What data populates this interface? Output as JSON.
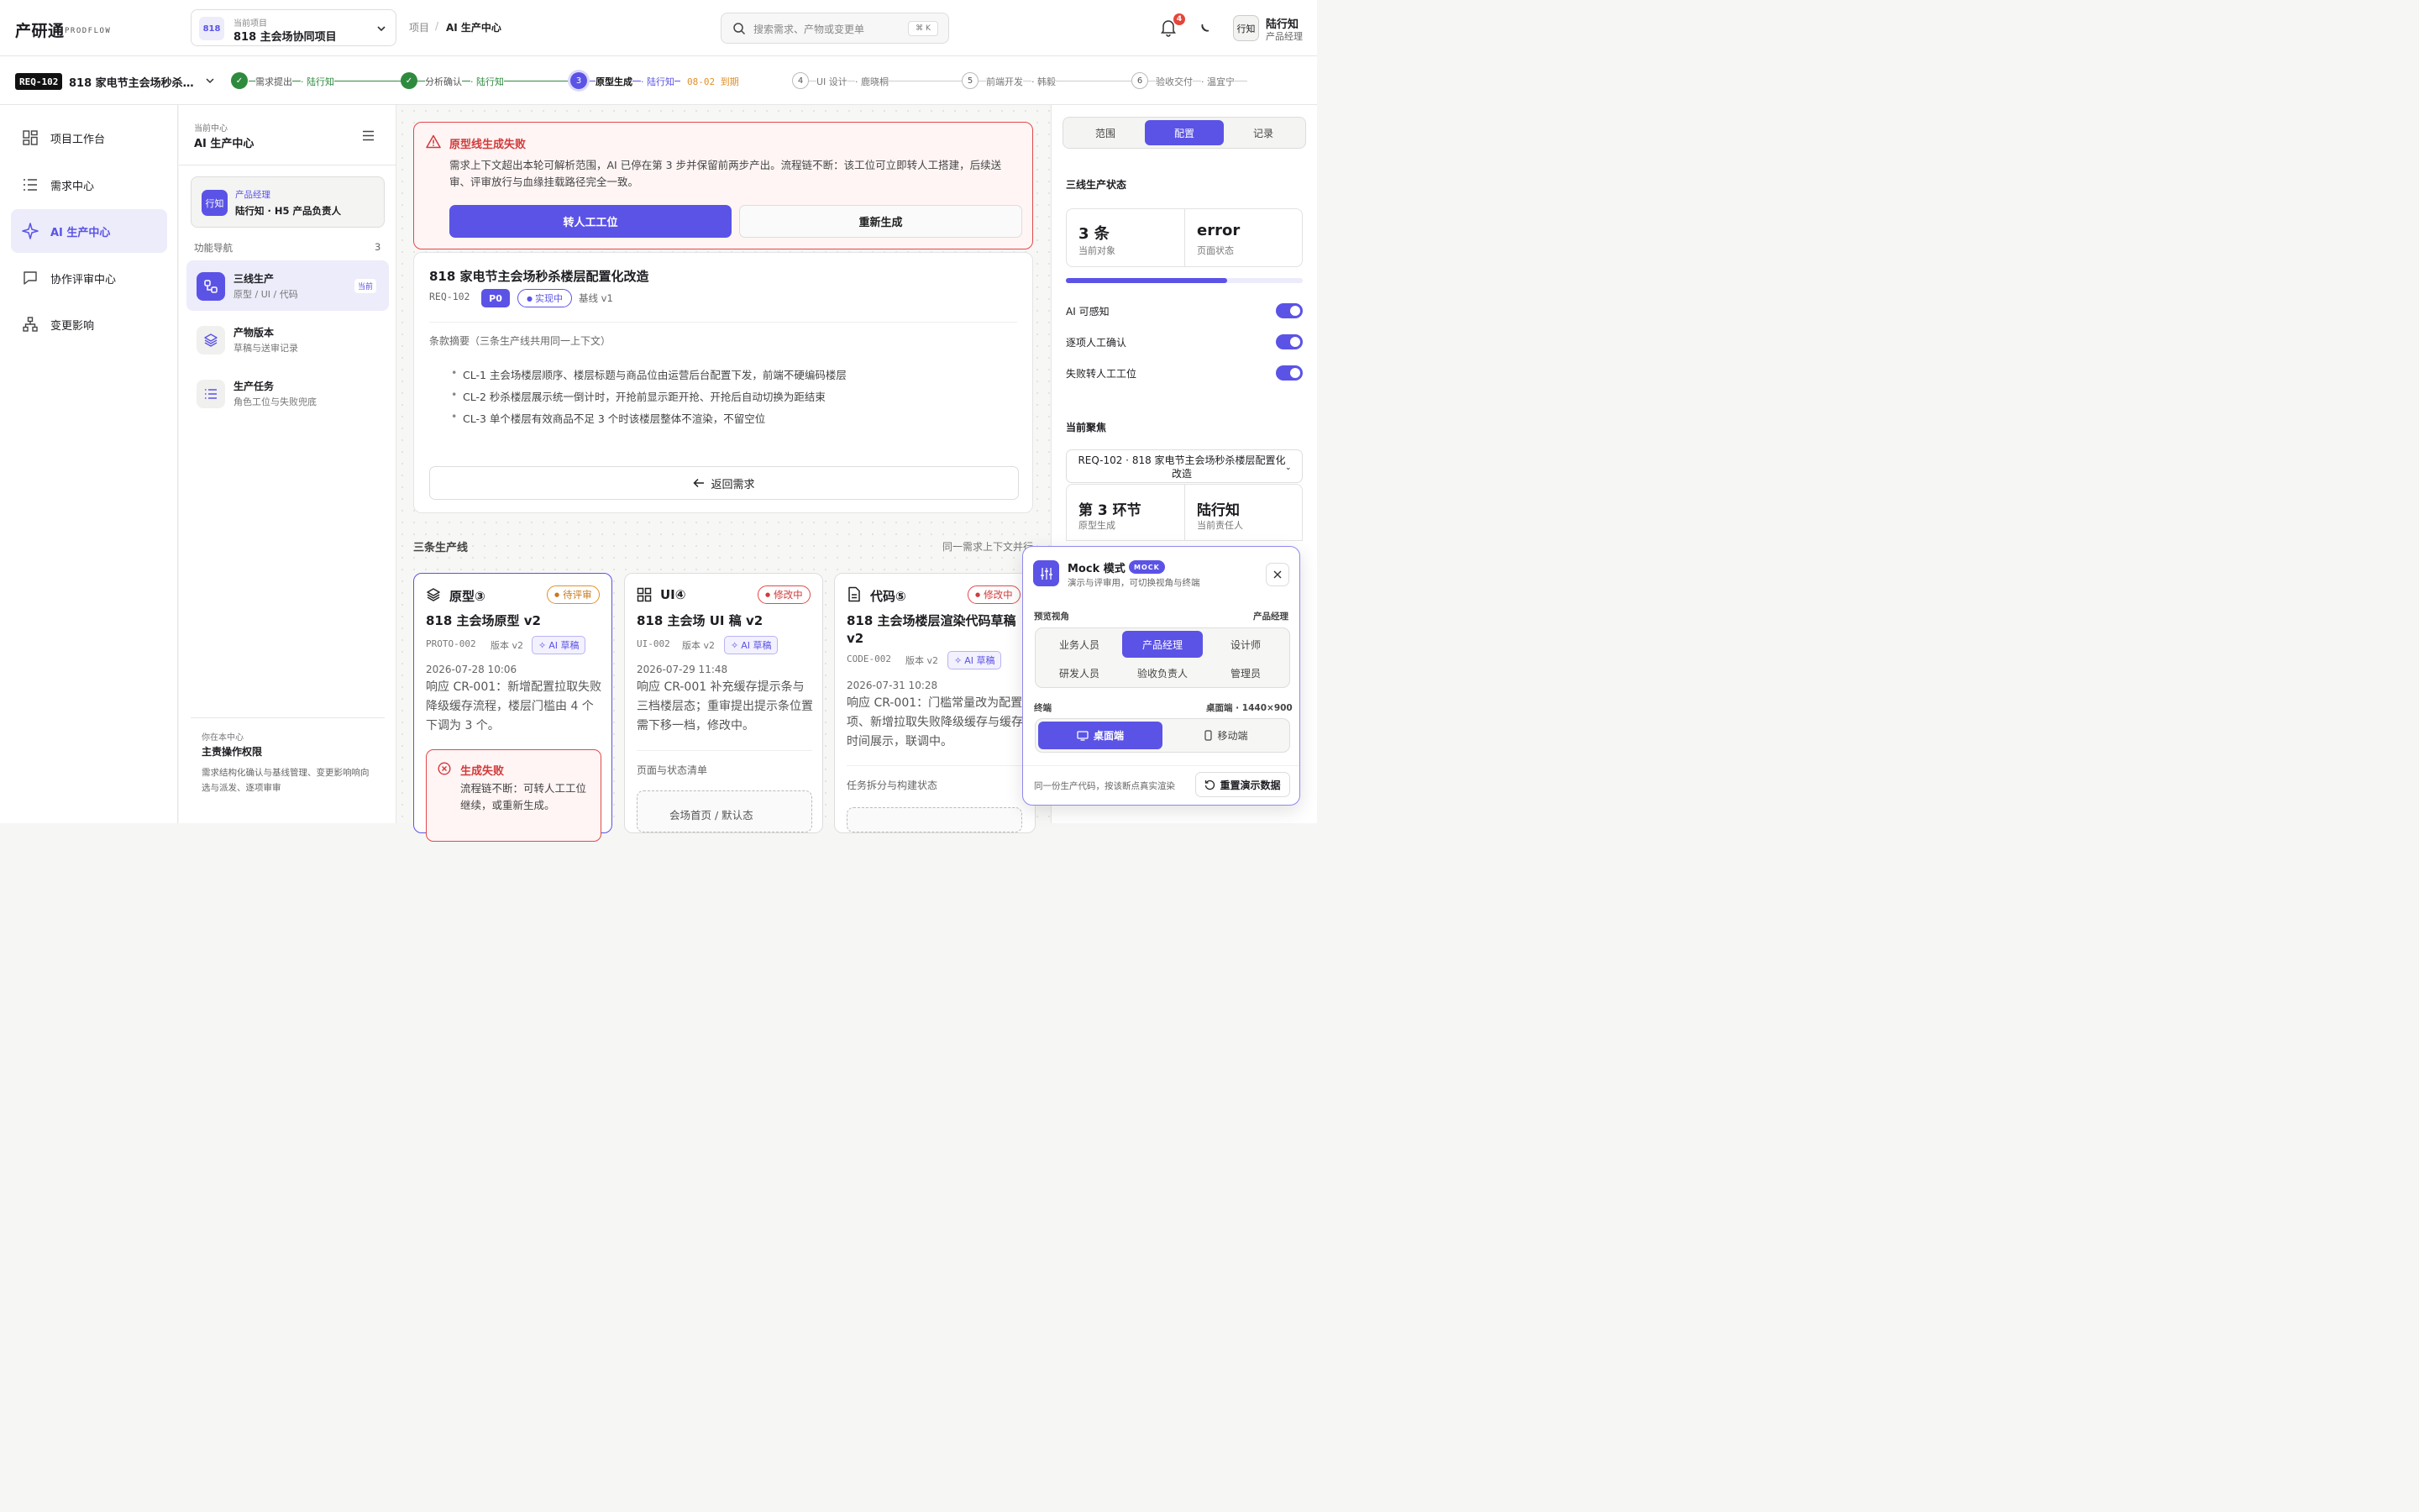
{
  "app": {
    "name": "产研通",
    "sub": "PRODFLOW"
  },
  "project": {
    "badge": "818",
    "label": "当前项目",
    "name": "818 主会场协同项目"
  },
  "breadcrumb": {
    "root": "项目",
    "sep": "/",
    "current": "AI 生产中心"
  },
  "search": {
    "placeholder": "搜索需求、产物或变更单",
    "shortcut": "⌘ K"
  },
  "notifications": {
    "count": "4"
  },
  "user": {
    "avatar": "行知",
    "name": "陆行知",
    "role": "产品经理"
  },
  "requirement": {
    "id": "REQ-102",
    "title": "818 家电节主会场秒杀…"
  },
  "steps": [
    {
      "num": "✓",
      "label": "需求提出",
      "owner": "· 陆行知",
      "state": "done"
    },
    {
      "num": "✓",
      "label": "分析确认",
      "owner": "· 陆行知",
      "state": "done"
    },
    {
      "num": "3",
      "label": "原型生成",
      "owner": "· 陆行知",
      "due": "08-02 到期",
      "state": "current"
    },
    {
      "num": "4",
      "label": "UI 设计",
      "owner": "· 鹿晓桐",
      "state": "todo"
    },
    {
      "num": "5",
      "label": "前端开发",
      "owner": "· 韩毅",
      "state": "todo"
    },
    {
      "num": "6",
      "label": "验收交付",
      "owner": "· 温宜宁",
      "state": "todo"
    }
  ],
  "nav": [
    {
      "label": "项目工作台",
      "icon": "dashboard-icon"
    },
    {
      "label": "需求中心",
      "icon": "list-icon"
    },
    {
      "label": "AI 生产中心",
      "icon": "sparkle-icon"
    },
    {
      "label": "协作评审中心",
      "icon": "chat-icon"
    },
    {
      "label": "变更影响",
      "icon": "hierarchy-icon"
    }
  ],
  "subnav": {
    "center_label": "当前中心",
    "center_name": "AI 生产中心",
    "role": {
      "avatar": "行知",
      "title": "产品经理",
      "desc": "陆行知 · H5 产品负责人"
    },
    "section": "功能导航",
    "count": "3",
    "items": [
      {
        "title": "三线生产",
        "sub": "原型 / UI / 代码",
        "tag": "当前"
      },
      {
        "title": "产物版本",
        "sub": "草稿与送审记录"
      },
      {
        "title": "生产任务",
        "sub": "角色工位与失败兜底"
      }
    ],
    "footer": {
      "label": "你在本中心",
      "title": "主责操作权限",
      "desc": "需求结构化确认与基线管理、变更影响响向选与派发、逐项审审"
    }
  },
  "error": {
    "title": "原型线生成失败",
    "text": "需求上下文超出本轮可解析范围，AI 已停在第 3 步并保留前两步产出。流程链不断：该工位可立即转人工搭建，后续送审、评审放行与血缘挂载路径完全一致。",
    "primary": "转人工工位",
    "secondary": "重新生成"
  },
  "req_card": {
    "title": "818 家电节主会场秒杀楼层配置化改造",
    "id": "REQ-102",
    "priority": "P0",
    "status": "实现中",
    "baseline": "基线 v1",
    "summary_label": "条款摘要（三条生产线共用同一上下文）",
    "clauses": [
      "CL-1 主会场楼层顺序、楼层标题与商品位由运营后台配置下发，前端不硬编码楼层",
      "CL-2 秒杀楼层展示统一倒计时，开抢前显示距开抢、开抢后自动切换为距结束",
      "CL-3 单个楼层有效商品不足 3 个时该楼层整体不渲染，不留空位"
    ],
    "back": "返回需求"
  },
  "lines_section": {
    "title": "三条生产线",
    "note": "同一需求上下文并行"
  },
  "lines": [
    {
      "title": "原型③",
      "status": "待评审",
      "name": "818 主会场原型 v2",
      "code": "PROTO-002",
      "version": "版本 v2",
      "ai": "AI 草稿",
      "date": "2026-07-28 10:06",
      "desc": "响应 CR-001：新增配置拉取失败降级缓存流程，楼层门槛由 4 个下调为 3 个。",
      "fail_title": "生成失败",
      "fail_text": "流程链不断：可转人工工位继续，或重新生成。"
    },
    {
      "title": "UI④",
      "status": "修改中",
      "name": "818 主会场 UI 稿 v2",
      "code": "UI-002",
      "version": "版本 v2",
      "ai": "AI 草稿",
      "date": "2026-07-29 11:48",
      "desc": "响应 CR-001 补充缓存提示条与三档楼层态；重审提出提示条位置需下移一档，修改中。",
      "list_label": "页面与状态清单",
      "list_item": "会场首页 / 默认态"
    },
    {
      "title": "代码⑤",
      "status": "修改中",
      "name": "818 主会场楼层渲染代码草稿 v2",
      "code": "CODE-002",
      "version": "版本 v2",
      "ai": "AI 草稿",
      "date": "2026-07-31 10:28",
      "desc": "响应 CR-001：门槛常量改为配置项、新增拉取失败降级缓存与缓存时间展示，联调中。",
      "list_label": "任务拆分与构建状态"
    }
  ],
  "right": {
    "tabs": [
      "范围",
      "配置",
      "记录"
    ],
    "state_title": "三线生产状态",
    "stats": [
      {
        "value": "3 条",
        "label": "当前对象"
      },
      {
        "value": "error",
        "label": "页面状态"
      }
    ],
    "progress": 0.68,
    "toggles": [
      "AI 可感知",
      "逐项人工确认",
      "失败转人工工位"
    ],
    "focus_title": "当前聚焦",
    "focus_select": "REQ-102 · 818 家电节主会场秒杀楼层配置化改造",
    "focus_stats": [
      {
        "value": "第 3 环节",
        "label": "原型生成"
      },
      {
        "value": "陆行知",
        "label": "当前责任人"
      }
    ]
  },
  "mock": {
    "title": "Mock 模式",
    "badge": "MOCK",
    "sub": "演示与评审用，可切换视角与终端",
    "view_label": "预览视角",
    "view_current": "产品经理",
    "roles": [
      "业务人员",
      "产品经理",
      "设计师",
      "研发人员",
      "验收负责人",
      "管理员"
    ],
    "device_label": "终端",
    "device_current": "桌面端 · 1440×900",
    "devices": [
      "桌面端",
      "移动端"
    ],
    "footer": "同一份生产代码，按该断点真实渲染",
    "reset": "重置演示数据"
  },
  "colors": {
    "accent": "#5b53e6",
    "error": "#e2484a",
    "done": "#2e8b3e",
    "warn": "#e0902a"
  }
}
